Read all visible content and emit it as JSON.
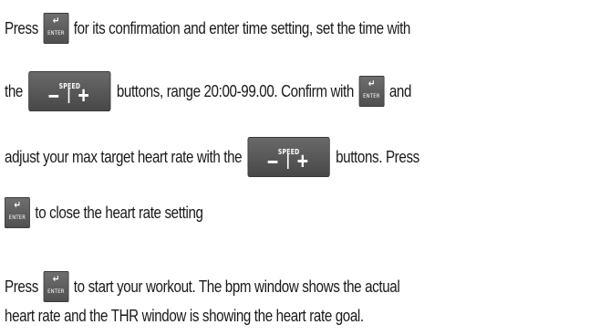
{
  "paragraph1": {
    "line1": {
      "a": "Press",
      "b": "for its confirmation and enter time setting, set the time with"
    },
    "line2": {
      "a": "the",
      "b": "buttons, range 20:00-99.00. Confirm with",
      "c": "and"
    },
    "line3": {
      "a": "adjust your max target heart rate with the",
      "b": "buttons. Press"
    },
    "line4": {
      "a": "to close the heart rate setting"
    }
  },
  "paragraph2": {
    "line1": {
      "a": "Press",
      "b": "to start your workout. The bpm window shows the actual"
    },
    "line2": {
      "a": "heart rate and the THR window is showing the heart rate goal."
    }
  },
  "buttons": {
    "enter": {
      "label": "ENTER",
      "icon": "enter-return-arrow-icon",
      "arrow": "↵"
    },
    "speed": {
      "label": "SPEED",
      "minus": "−",
      "plus": "+",
      "icon": "speed-minus-plus-icon"
    }
  },
  "colors": {
    "button_face": "#5a5a5a",
    "button_text": "#ffffff",
    "text": "#1a1a1a"
  }
}
